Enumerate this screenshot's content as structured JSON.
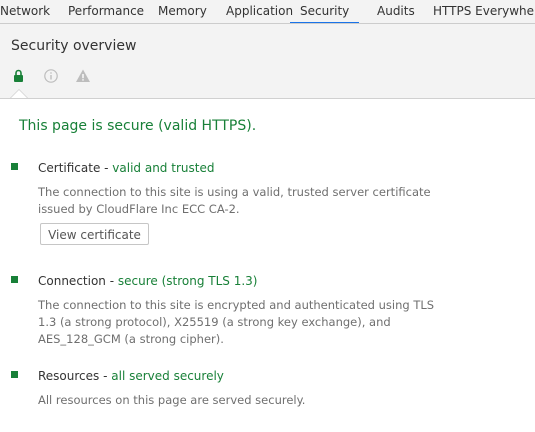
{
  "tabs": [
    {
      "label": "Network"
    },
    {
      "label": "Performance"
    },
    {
      "label": "Memory"
    },
    {
      "label": "Application"
    },
    {
      "label": "Security",
      "active": true
    },
    {
      "label": "Audits"
    },
    {
      "label": "HTTPS Everywhere"
    }
  ],
  "overview": {
    "title": "Security overview",
    "icons": [
      "lock-icon",
      "info-icon",
      "warning-icon"
    ]
  },
  "summary": {
    "text": "This page is secure (valid HTTPS)."
  },
  "sections": {
    "certificate": {
      "title": "Certificate - ",
      "status": "valid and trusted",
      "description": "The connection to this site is using a valid, trusted server certificate issued by CloudFlare Inc ECC CA-2.",
      "button_label": "View certificate"
    },
    "connection": {
      "title": "Connection - ",
      "status": "secure (strong TLS 1.3)",
      "description": "The connection to this site is encrypted and authenticated using TLS 1.3 (a strong protocol), X25519 (a strong key exchange), and AES_128_GCM (a strong cipher)."
    },
    "resources": {
      "title": "Resources - ",
      "status": "all served securely",
      "description": "All resources on this page are served securely."
    }
  },
  "colors": {
    "secure_green": "#188038",
    "active_tab_underline": "#1a73e8",
    "muted_text": "#6f6f6f"
  }
}
